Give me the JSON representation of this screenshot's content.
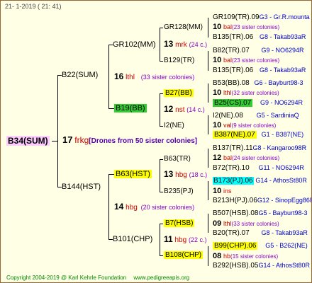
{
  "header": "21-  1-2019 (  21:  41)",
  "footer": {
    "copyright": "Copyright 2004-2019 @ Karl Kehrle Foundation",
    "url": "www.pedigreeapis.org"
  },
  "root": {
    "name": "B34(SUM)",
    "count": "17",
    "queen": "frkg",
    "colonies": "[Drones from 50 sister colonies]"
  },
  "gen2": [
    {
      "name": "B22(SUM)",
      "count": "16",
      "queen": "lthl",
      "colonies": "(33 sister colonies)"
    },
    {
      "name": "B144(HST)",
      "count": "14",
      "queen": "hbg",
      "colonies": "(20 sister colonies)"
    }
  ],
  "gen3": [
    {
      "name": "GR102(MM)",
      "count": "13",
      "queen": "mrk",
      "colonies": "(24 c.)"
    },
    {
      "name": "B19(BB)",
      "count": "12",
      "queen": "nst",
      "colonies": "(14 c.)"
    },
    {
      "name": "B63(HST)",
      "count": "13",
      "queen": "hbg",
      "colonies": "(18 c.)"
    },
    {
      "name": "B101(CHP)",
      "count": "11",
      "queen": "hbg",
      "colonies": "(22 c.)"
    }
  ],
  "gen4": [
    "GR128(MM)",
    "B129(TR)",
    "B27(BB)",
    "I2(NE)",
    "B63(TR)",
    "B235(PJ)",
    "B7(HSB)",
    "B108(CHP)"
  ],
  "gen5": [
    {
      "name": "GR109(TR).09",
      "line": "G3 - Gr.R.mounta"
    },
    {
      "count": "10",
      "queen": "bal",
      "colonies": "(23 sister colonies)"
    },
    {
      "name": "B135(TR).06",
      "line": "G8 - Takab93aR"
    },
    {
      "name": "B82(TR).07",
      "line": "G9 - NO6294R"
    },
    {
      "count": "10",
      "queen": "bal",
      "colonies": "(23 sister colonies)"
    },
    {
      "name": "B135(TR).06",
      "line": "G8 - Takab93aR"
    },
    {
      "name": "B53(BB).08",
      "line": "G6 - Bayburt98-3"
    },
    {
      "count": "10",
      "queen": "lthl",
      "colonies": "(32 sister colonies)"
    },
    {
      "name": "B25(CS).07",
      "line": "G9 - NO6294R"
    },
    {
      "name": "I2(NE).08",
      "line": "G5 - SardiniaQ"
    },
    {
      "count": "10",
      "queen": "val",
      "colonies": "(9 sister colonies)"
    },
    {
      "name": "B387(NE).07",
      "line": "G1 - B387(NE)"
    },
    {
      "name": "B137(TR).11",
      "line": "G8 - Kangaroo98R"
    },
    {
      "count": "12",
      "queen": "bal",
      "colonies": "(24 sister colonies)"
    },
    {
      "name": "B72(TR).10",
      "line": "G11 - NO6294R"
    },
    {
      "name": "B173(PJ).06",
      "line": "G14 - AthosSt80R"
    },
    {
      "count": "10",
      "queen": "ins",
      "colonies": ""
    },
    {
      "name": "B213H(PJ).06",
      "line": "G12 - SinopEgg86R"
    },
    {
      "name": "B507(HSB).08",
      "line": "G5 - Bayburt98-3"
    },
    {
      "count": "09",
      "queen": "lthl",
      "colonies": "(33 sister colonies)"
    },
    {
      "name": "B20(TR).07",
      "line": "G8 - Takab93aR"
    },
    {
      "name": "B99(CHP).06",
      "line": "G5 - B262(NE)"
    },
    {
      "count": "08",
      "queen": "hb",
      "colonies": "(15 sister colonies)"
    },
    {
      "name": "B292(HSB).05",
      "line": "G14 - AthosSt80R"
    }
  ],
  "colors": {
    "background": "#ffffe6",
    "border": "#996633",
    "root_highlight": "#ffccff",
    "yellow": "#ffff00",
    "green": "#33cc33",
    "cyan": "#00ffff",
    "queen_red": "#cc0000",
    "colonies_purple": "#8800cc",
    "line_blue": "#0000cc"
  }
}
